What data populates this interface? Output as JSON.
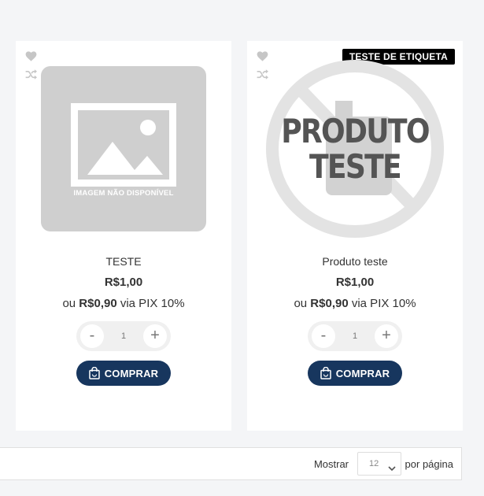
{
  "products": [
    {
      "name": "TESTE",
      "price": "R$1,00",
      "pix_prefix": "ou",
      "pix_price": "R$0,90",
      "pix_suffix": "via PIX 10%",
      "image_text": "IMAGEM NÃO DISPONÍVEL",
      "quantity": "1",
      "minus": "-",
      "plus": "+",
      "buy_label": "COMPRAR",
      "tag": ""
    },
    {
      "name": "Produto teste",
      "price": "R$1,00",
      "pix_prefix": "ou",
      "pix_price": "R$0,90",
      "pix_suffix": "via PIX 10%",
      "image_text_line1": "PRODUTO",
      "image_text_line2": "TESTE",
      "quantity": "1",
      "minus": "-",
      "plus": "+",
      "buy_label": "COMPRAR",
      "tag": "TESTE DE ETIQUETA"
    }
  ],
  "pagination": {
    "show_label": "Mostrar",
    "per_page_value": "12",
    "per_page_label": "por página"
  },
  "icons": {
    "wishlist": "heart-icon",
    "compare": "shuffle-icon",
    "buy": "shopping-bag-icon",
    "select": "chevron-down-icon"
  },
  "colors": {
    "background": "#f4f5f7",
    "button": "#17365e",
    "tag_background": "#000000",
    "placeholder": "#cfcfcf"
  }
}
